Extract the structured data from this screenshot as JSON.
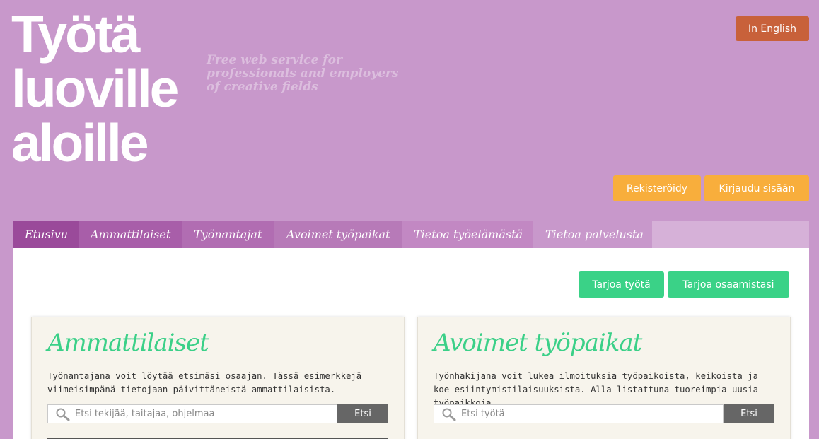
{
  "header": {
    "logo_lines": [
      "Työtä",
      "luoville",
      "aloille"
    ],
    "tagline_lines": [
      "Free web service for",
      "professionals and employers",
      "of creative fields"
    ],
    "language_button": "In English",
    "register_button": "Rekisteröidy",
    "login_button": "Kirjaudu sisään"
  },
  "nav": {
    "items": [
      {
        "label": "Etusivu"
      },
      {
        "label": "Ammattilaiset"
      },
      {
        "label": "Työnantajat"
      },
      {
        "label": "Avoimet työpaikat"
      },
      {
        "label": "Tietoa työelämästä"
      },
      {
        "label": "Tietoa palvelusta"
      }
    ]
  },
  "actions": {
    "offer_job": "Tarjoa työtä",
    "offer_skills": "Tarjoa osaamistasi"
  },
  "cards": {
    "professionals": {
      "title": "Ammattilaiset",
      "description": "Työnantajana voit löytää etsimäsi osaajan. Tässä esimerkkejä viimeisimpänä tietojaan päivittäneistä ammattilaisista.",
      "search_placeholder": "Etsi tekijää, taitajaa, ohjelmaa",
      "search_button": "Etsi"
    },
    "jobs": {
      "title": "Avoimet työpaikat",
      "description": "Työnhakijana voit lukea ilmoituksia työpaikoista, keikoista ja koe-esiintymistilaisuuksista. Alla listattuna tuoreimpia uusia työpaikkoja.",
      "search_placeholder": "Etsi työtä",
      "search_button": "Etsi"
    }
  },
  "colors": {
    "background": "#c898cb",
    "language_button": "#c8613a",
    "auth_buttons": "#f8ae3c",
    "green_accent": "#3ad287",
    "search_button": "#666666"
  },
  "icons": {
    "search": "magnifier-icon"
  }
}
